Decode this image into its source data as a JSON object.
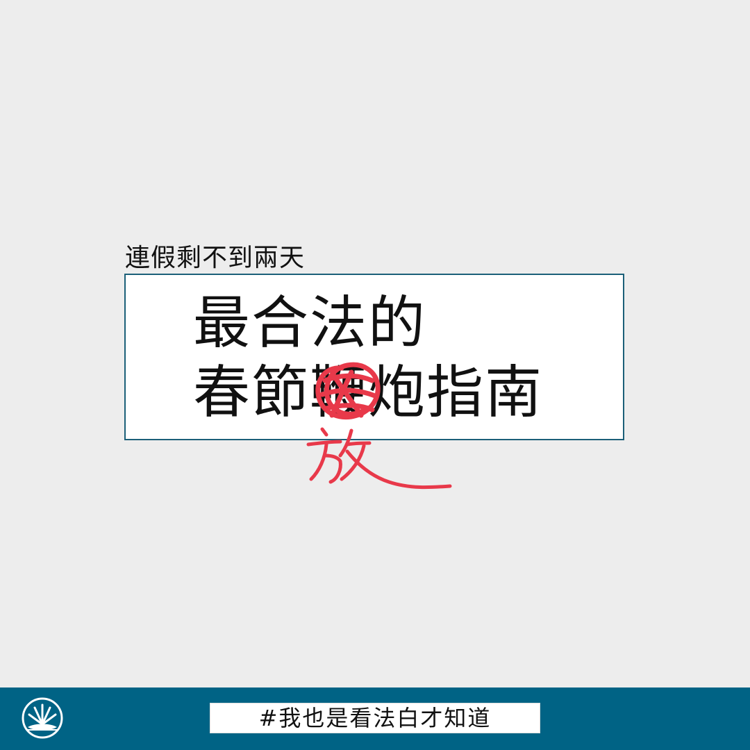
{
  "subtitle": "連假剩不到兩天",
  "title": {
    "line1": "最合法的",
    "line2": "春節鞭炮指南"
  },
  "correction": {
    "replacement": "放"
  },
  "footer": {
    "hashtag": "#我也是看法白才知道"
  },
  "colors": {
    "background": "#ededed",
    "box_border": "#1b5f78",
    "footer_bg": "#006385",
    "correction_red": "#e8394a"
  },
  "icons": {
    "logo": "scales-fan-logo-icon"
  }
}
